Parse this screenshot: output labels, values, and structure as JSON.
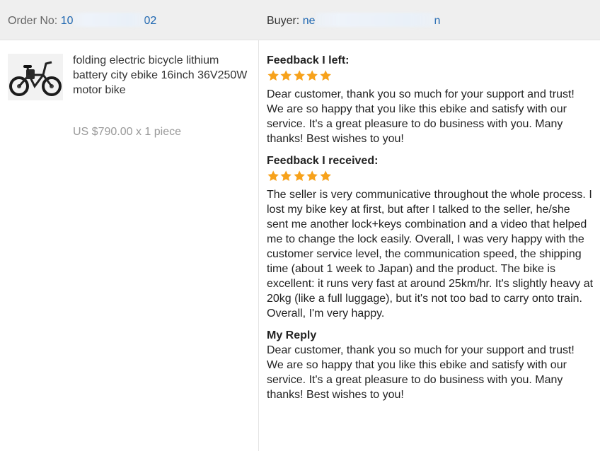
{
  "header": {
    "order_label": "Order No:",
    "order_value_start": "10",
    "order_value_end": "02",
    "buyer_label": "Buyer:",
    "buyer_value_start": "ne",
    "buyer_value_end": "n"
  },
  "product": {
    "image_icon": "folding-ebike-photo",
    "title": "folding electric bicycle lithium battery city ebike 16inch 36V250W motor bike",
    "price": "US $790.00 x 1 piece"
  },
  "feedback_left": {
    "title": "Feedback I left:",
    "rating": 5,
    "text": "Dear customer, thank you so much for your support and trust! We are so happy that you like this ebike and satisfy with our service. It's a great pleasure to do business with you. Many thanks! Best wishes to you!"
  },
  "feedback_received": {
    "title": "Feedback I received:",
    "rating": 5,
    "text": "The seller is very communicative throughout the whole process. I lost my bike key at first, but after I talked to the seller, he/she sent me another lock+keys combination and a video that helped me to change the lock easily. Overall, I was very happy with the customer service level, the communication speed, the shipping time (about 1 week to Japan) and the product. The bike is excellent: it runs very fast at around 25km/hr. It's slightly heavy at 20kg (like a full luggage), but it's not too bad to carry onto train. Overall, I'm very happy."
  },
  "reply": {
    "title": "My Reply",
    "text": "Dear customer, thank you so much for your support and trust! We are so happy that you like this ebike and satisfy with our service. It's a great pleasure to do business with you. Many thanks! Best wishes to you!"
  },
  "colors": {
    "star": "#f7a21b",
    "link": "#1a64b0",
    "header_bg": "#efefef"
  }
}
